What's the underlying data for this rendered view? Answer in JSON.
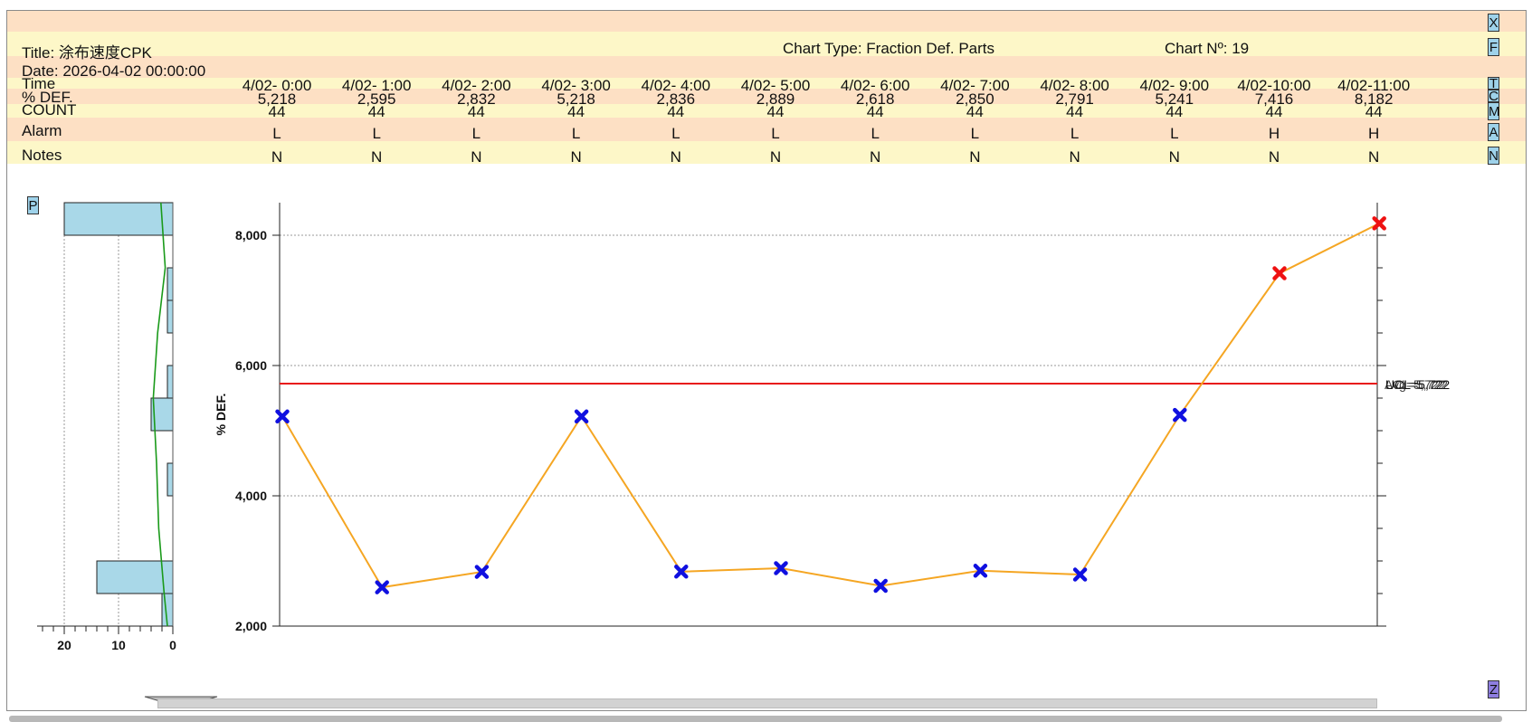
{
  "header": {
    "title": "Title: 涂布速度CPK",
    "chart_type": "Chart Type: Fraction Def. Parts",
    "chart_no": "Chart Nº: 19",
    "date": "Date: 2026-04-02 00:00:00"
  },
  "row_labels": {
    "time": "Time",
    "pct_def": "% DEF.",
    "count": "COUNT",
    "alarm": "Alarm",
    "notes": "Notes"
  },
  "columns": [
    {
      "time": "4/02- 0:00",
      "pct_def": "5,218",
      "count": "44",
      "alarm": "L",
      "note": "N"
    },
    {
      "time": "4/02- 1:00",
      "pct_def": "2,595",
      "count": "44",
      "alarm": "L",
      "note": "N"
    },
    {
      "time": "4/02- 2:00",
      "pct_def": "2,832",
      "count": "44",
      "alarm": "L",
      "note": "N"
    },
    {
      "time": "4/02- 3:00",
      "pct_def": "5,218",
      "count": "44",
      "alarm": "L",
      "note": "N"
    },
    {
      "time": "4/02- 4:00",
      "pct_def": "2,836",
      "count": "44",
      "alarm": "L",
      "note": "N"
    },
    {
      "time": "4/02- 5:00",
      "pct_def": "2,889",
      "count": "44",
      "alarm": "L",
      "note": "N"
    },
    {
      "time": "4/02- 6:00",
      "pct_def": "2,618",
      "count": "44",
      "alarm": "L",
      "note": "N"
    },
    {
      "time": "4/02- 7:00",
      "pct_def": "2,850",
      "count": "44",
      "alarm": "L",
      "note": "N"
    },
    {
      "time": "4/02- 8:00",
      "pct_def": "2,791",
      "count": "44",
      "alarm": "L",
      "note": "N"
    },
    {
      "time": "4/02- 9:00",
      "pct_def": "5,241",
      "count": "44",
      "alarm": "L",
      "note": "N"
    },
    {
      "time": "4/02-10:00",
      "pct_def": "7,416",
      "count": "44",
      "alarm": "H",
      "note": "N"
    },
    {
      "time": "4/02-11:00",
      "pct_def": "8,182",
      "count": "44",
      "alarm": "H",
      "note": "N"
    }
  ],
  "side_buttons": [
    "X",
    "F",
    "T",
    "C",
    "M",
    "A",
    "N"
  ],
  "p_button": "P",
  "z_button": "Z",
  "colors": {
    "line": "#f5a623",
    "point_normal": "#1010e0",
    "point_alarm": "#ee1111",
    "ucl": "#e81818",
    "hist_fill": "#a9d8e8",
    "hist_curve": "#1a9a1a",
    "band_peach": "#fde0c4",
    "band_cream": "#fdf7c8",
    "button": "#9ed2ea",
    "z_button": "#8e7ee0"
  },
  "chart_data": [
    {
      "type": "line",
      "ylabel": "% DEF.",
      "ylim": [
        2000,
        8500
      ],
      "yticks": [
        2000,
        4000,
        6000,
        8000
      ],
      "ytick_labels": [
        "2,000",
        "4,000",
        "6,000",
        "8,000"
      ],
      "x": [
        "4/02- 0:00",
        "4/02- 1:00",
        "4/02- 2:00",
        "4/02- 3:00",
        "4/02- 4:00",
        "4/02- 5:00",
        "4/02- 6:00",
        "4/02- 7:00",
        "4/02- 8:00",
        "4/02- 9:00",
        "4/02-10:00",
        "4/02-11:00"
      ],
      "values": [
        5218,
        2595,
        2832,
        5218,
        2836,
        2889,
        2618,
        2850,
        2791,
        5241,
        7416,
        8182
      ],
      "alarm": [
        false,
        false,
        false,
        false,
        false,
        false,
        false,
        false,
        false,
        false,
        true,
        true
      ],
      "ucl_value": 5722,
      "ucl_label": "UCL=5,722",
      "ucl_label_overprint": [
        "LCL=5,722",
        "Avg=5,722"
      ],
      "grid": true
    },
    {
      "type": "bar",
      "orientation": "horizontal",
      "xlim": [
        0,
        25
      ],
      "xticks": [
        0,
        10,
        20
      ],
      "xtick_labels": [
        "0",
        "10",
        "20"
      ],
      "bins": [
        {
          "from": 8000,
          "to": 8500,
          "count": 20
        },
        {
          "from": 7000,
          "to": 7500,
          "count": 1
        },
        {
          "from": 6500,
          "to": 7000,
          "count": 1
        },
        {
          "from": 5500,
          "to": 6000,
          "count": 1
        },
        {
          "from": 5000,
          "to": 5500,
          "count": 4
        },
        {
          "from": 4500,
          "to": 5000,
          "count": 0
        },
        {
          "from": 4000,
          "to": 4500,
          "count": 1
        },
        {
          "from": 2500,
          "to": 3000,
          "count": 14
        },
        {
          "from": 2000,
          "to": 2500,
          "count": 2
        }
      ],
      "curve": [
        [
          2.2,
          8500
        ],
        [
          1.4,
          7500
        ],
        [
          2.8,
          6500
        ],
        [
          3.6,
          5500
        ],
        [
          3.0,
          4500
        ],
        [
          2.6,
          3500
        ],
        [
          1.6,
          2500
        ],
        [
          1.0,
          2000
        ]
      ]
    }
  ]
}
